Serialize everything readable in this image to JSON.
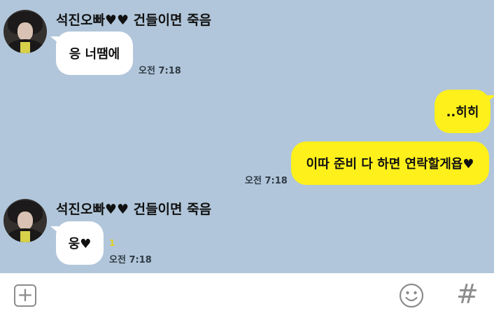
{
  "chat": {
    "background": "#b1c6da",
    "messages": [
      {
        "sender": "석진오빠♥♥ 건들이면 죽음",
        "text": "응 너땜에",
        "time": "오전 7:18",
        "direction": "incoming"
      },
      {
        "text": "..히히",
        "direction": "outgoing"
      },
      {
        "text": "이따 준비 다 하면 연락할게욥♥",
        "time": "오전 7:18",
        "direction": "outgoing"
      },
      {
        "sender": "석진오빠♥♥ 건들이면 죽음",
        "text": "웅♥",
        "unread": "1",
        "time": "오전 7:18",
        "direction": "incoming"
      }
    ]
  },
  "colors": {
    "outgoing_bubble": "#fef01b",
    "incoming_bubble": "#ffffff",
    "unread_count": "#e2d21c"
  },
  "input_bar": {
    "icons": [
      "plus-icon",
      "smiley-icon",
      "hash-icon"
    ]
  }
}
